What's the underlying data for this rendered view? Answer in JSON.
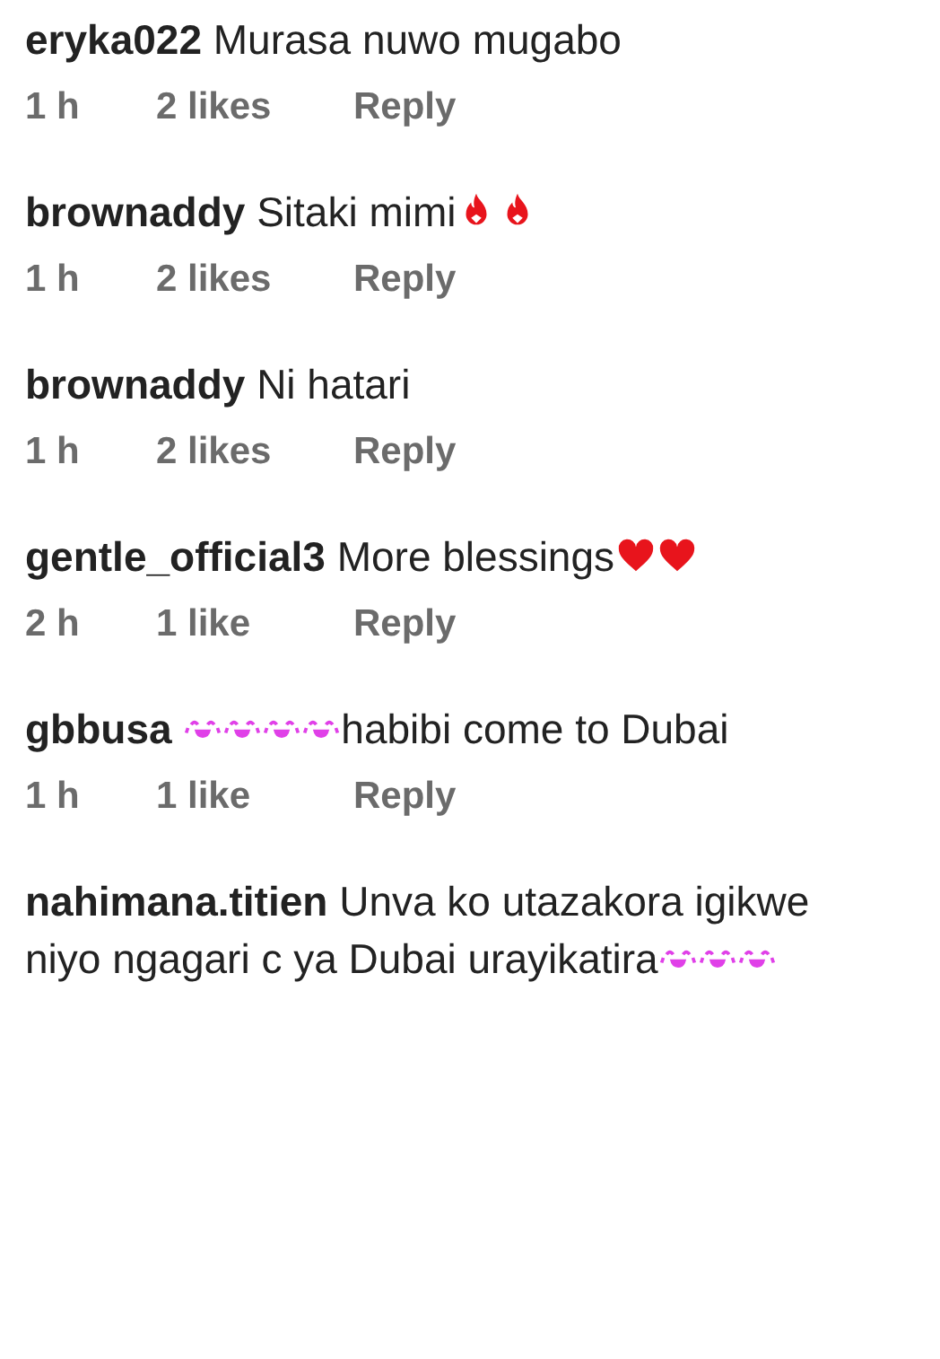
{
  "comments": [
    {
      "username": "eryka022",
      "parts": [
        {
          "kind": "text",
          "text": "Murasa nuwo mugabo"
        }
      ],
      "time": "1 h",
      "likes": "2 likes",
      "reply": "Reply"
    },
    {
      "username": "brownaddy",
      "parts": [
        {
          "kind": "text",
          "text": "Sitaki mimi"
        },
        {
          "kind": "fire"
        },
        {
          "kind": "fire"
        }
      ],
      "time": "1 h",
      "likes": "2 likes",
      "reply": "Reply"
    },
    {
      "username": "brownaddy",
      "parts": [
        {
          "kind": "text",
          "text": "Ni hatari"
        }
      ],
      "time": "1 h",
      "likes": "2 likes",
      "reply": "Reply"
    },
    {
      "username": "gentle_official3",
      "parts": [
        {
          "kind": "text",
          "text": "More blessings"
        },
        {
          "kind": "heart"
        },
        {
          "kind": "heart"
        }
      ],
      "time": "2 h",
      "likes": "1 like",
      "reply": "Reply"
    },
    {
      "username": "gbbusa",
      "parts": [
        {
          "kind": "laugh"
        },
        {
          "kind": "laugh"
        },
        {
          "kind": "laugh"
        },
        {
          "kind": "laugh"
        },
        {
          "kind": "text",
          "text": "habibi come to Dubai"
        }
      ],
      "time": "1 h",
      "likes": "1 like",
      "reply": "Reply"
    },
    {
      "username": "nahimana.titien",
      "parts": [
        {
          "kind": "text",
          "text": "Unva ko utazakora igikwe niyo ngagari c ya Dubai urayikatira"
        },
        {
          "kind": "laugh"
        },
        {
          "kind": "laugh"
        },
        {
          "kind": "laugh"
        }
      ]
    }
  ]
}
